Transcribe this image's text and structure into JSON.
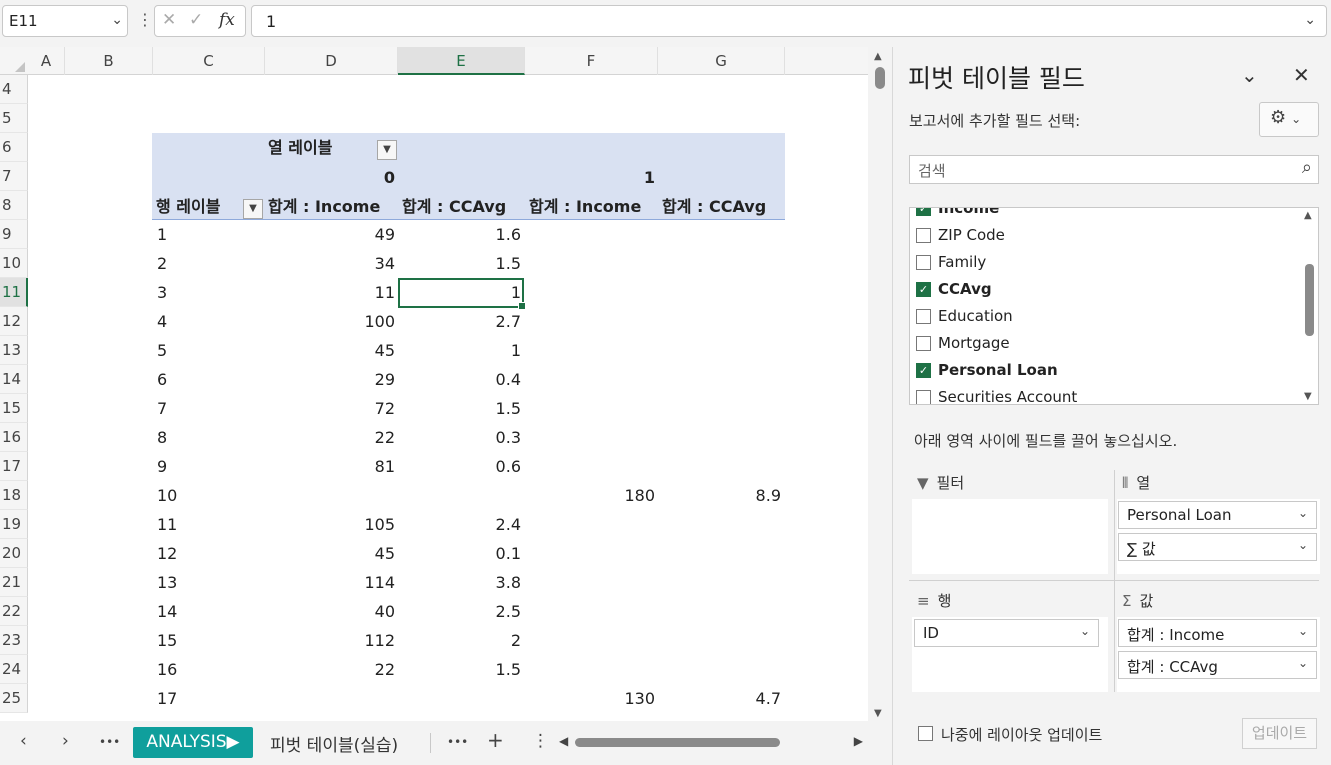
{
  "formula_bar": {
    "name_box": "E11",
    "formula": "1",
    "fx_label": "fx"
  },
  "grid": {
    "columns": [
      "A",
      "B",
      "C",
      "D",
      "E",
      "F",
      "G"
    ],
    "selected_column": "E",
    "selected_row": "11",
    "row_numbers": [
      "4",
      "5",
      "6",
      "7",
      "8",
      "9",
      "10",
      "11",
      "12",
      "13",
      "14",
      "15",
      "16",
      "17",
      "18",
      "19",
      "20",
      "21",
      "22",
      "23",
      "24",
      "25"
    ]
  },
  "pivot": {
    "column_label": "열 레이블",
    "row_label": "행 레이블",
    "col_group_0": "0",
    "col_group_1": "1",
    "measure_headers": [
      "합계 : Income",
      "합계 : CCAvg",
      "합계 : Income",
      "합계 : CCAvg"
    ],
    "rows": [
      {
        "id": "1",
        "inc0": "49",
        "cc0": "1.6",
        "inc1": "",
        "cc1": ""
      },
      {
        "id": "2",
        "inc0": "34",
        "cc0": "1.5",
        "inc1": "",
        "cc1": ""
      },
      {
        "id": "3",
        "inc0": "11",
        "cc0": "1",
        "inc1": "",
        "cc1": ""
      },
      {
        "id": "4",
        "inc0": "100",
        "cc0": "2.7",
        "inc1": "",
        "cc1": ""
      },
      {
        "id": "5",
        "inc0": "45",
        "cc0": "1",
        "inc1": "",
        "cc1": ""
      },
      {
        "id": "6",
        "inc0": "29",
        "cc0": "0.4",
        "inc1": "",
        "cc1": ""
      },
      {
        "id": "7",
        "inc0": "72",
        "cc0": "1.5",
        "inc1": "",
        "cc1": ""
      },
      {
        "id": "8",
        "inc0": "22",
        "cc0": "0.3",
        "inc1": "",
        "cc1": ""
      },
      {
        "id": "9",
        "inc0": "81",
        "cc0": "0.6",
        "inc1": "",
        "cc1": ""
      },
      {
        "id": "10",
        "inc0": "",
        "cc0": "",
        "inc1": "180",
        "cc1": "8.9"
      },
      {
        "id": "11",
        "inc0": "105",
        "cc0": "2.4",
        "inc1": "",
        "cc1": ""
      },
      {
        "id": "12",
        "inc0": "45",
        "cc0": "0.1",
        "inc1": "",
        "cc1": ""
      },
      {
        "id": "13",
        "inc0": "114",
        "cc0": "3.8",
        "inc1": "",
        "cc1": ""
      },
      {
        "id": "14",
        "inc0": "40",
        "cc0": "2.5",
        "inc1": "",
        "cc1": ""
      },
      {
        "id": "15",
        "inc0": "112",
        "cc0": "2",
        "inc1": "",
        "cc1": ""
      },
      {
        "id": "16",
        "inc0": "22",
        "cc0": "1.5",
        "inc1": "",
        "cc1": ""
      },
      {
        "id": "17",
        "inc0": "",
        "cc0": "",
        "inc1": "130",
        "cc1": "4.7"
      }
    ]
  },
  "sheet_tabs": {
    "active": "ANALYSIS",
    "other": "피벗 테이블(실습)",
    "more": "•••",
    "add": "+",
    "menu": "⋮",
    "prev": "‹",
    "next": "›"
  },
  "field_pane": {
    "title": "피벗 테이블 필드",
    "subtitle": "보고서에 추가할 필드 선택:",
    "search_placeholder": "검색",
    "fields": [
      {
        "label": "Income",
        "checked": true
      },
      {
        "label": "ZIP Code",
        "checked": false
      },
      {
        "label": "Family",
        "checked": false
      },
      {
        "label": "CCAvg",
        "checked": true
      },
      {
        "label": "Education",
        "checked": false
      },
      {
        "label": "Mortgage",
        "checked": false
      },
      {
        "label": "Personal Loan",
        "checked": true
      },
      {
        "label": "Securities Account",
        "checked": false
      }
    ],
    "drag_hint": "아래 영역 사이에 필드를 끌어 놓으십시오.",
    "areas": {
      "filter_label": "필터",
      "columns_label": "열",
      "rows_label": "행",
      "values_label": "값",
      "column_items": [
        "Personal Loan",
        "∑ 값"
      ],
      "row_items": [
        "ID"
      ],
      "value_items": [
        "합계 : Income",
        "합계 : CCAvg"
      ]
    },
    "defer_label": "나중에 레이아웃 업데이트",
    "update_button": "업데이트",
    "accent_color": "#1e7145"
  }
}
